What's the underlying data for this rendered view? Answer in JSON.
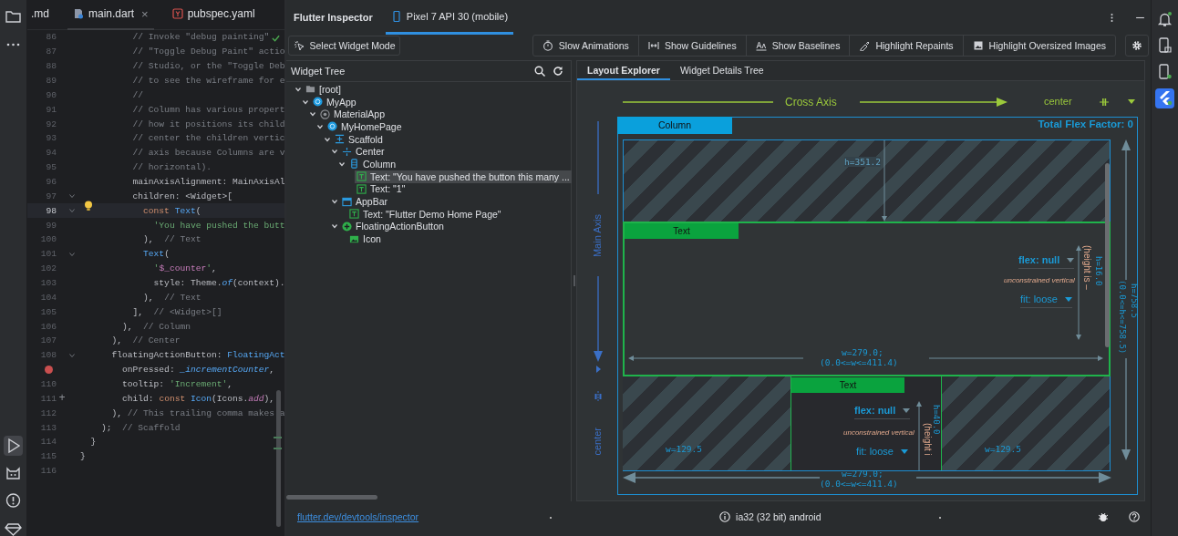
{
  "left_toolbar": {
    "top": [
      {
        "kind": "folder",
        "selected": false
      },
      {
        "kind": "more",
        "selected": false
      }
    ],
    "bottom": [
      {
        "kind": "run",
        "selected": true
      },
      {
        "kind": "cat",
        "selected": false
      },
      {
        "kind": "problems",
        "selected": false
      },
      {
        "kind": "gem",
        "selected": false
      }
    ]
  },
  "editor": {
    "tabs": [
      {
        "label": ".md",
        "kind": "md",
        "selected": false,
        "closable": false
      },
      {
        "label": "main.dart",
        "kind": "dart",
        "selected": true,
        "closable": true
      },
      {
        "label": "pubspec.yaml",
        "kind": "yaml",
        "selected": false,
        "closable": false
      }
    ],
    "close_glyph": "×",
    "lines": [
      {
        "number": "86",
        "tokens": [
          {
            "kind": "comment",
            "text": "          // Invoke \"debug painting\""
          }
        ]
      },
      {
        "number": "87",
        "tokens": [
          {
            "kind": "comment",
            "text": "          // \"Toggle Debug Paint\" actio"
          }
        ]
      },
      {
        "number": "88",
        "tokens": [
          {
            "kind": "comment",
            "text": "          // Studio, or the \"Toggle Deb"
          }
        ]
      },
      {
        "number": "89",
        "tokens": [
          {
            "kind": "comment",
            "text": "          // to see the wireframe for e"
          }
        ]
      },
      {
        "number": "90",
        "tokens": [
          {
            "kind": "comment",
            "text": "          //"
          }
        ]
      },
      {
        "number": "91",
        "tokens": [
          {
            "kind": "comment",
            "text": "          // Column has various propert"
          }
        ]
      },
      {
        "number": "92",
        "tokens": [
          {
            "kind": "comment",
            "text": "          // how it positions its child"
          }
        ]
      },
      {
        "number": "93",
        "tokens": [
          {
            "kind": "comment",
            "text": "          // center the children vertic"
          }
        ]
      },
      {
        "number": "94",
        "tokens": [
          {
            "kind": "comment",
            "text": "          // axis because Columns are v"
          }
        ]
      },
      {
        "number": "95",
        "tokens": [
          {
            "kind": "comment",
            "text": "          // horizontal)."
          }
        ]
      },
      {
        "number": "96",
        "tokens": [
          {
            "kind": "plain",
            "text": "          mainAxisAlignment: MainAxisAl"
          }
        ]
      },
      {
        "number": "97",
        "fold": true,
        "tokens": [
          {
            "kind": "plain",
            "text": "          children: <Widget>["
          }
        ]
      },
      {
        "number": "98",
        "fold": true,
        "current": true,
        "bulb": true,
        "tokens": [
          {
            "kind": "keyword",
            "text": "            const"
          },
          {
            "kind": "class",
            "text": " Text"
          },
          {
            "kind": "plain",
            "text": "("
          }
        ]
      },
      {
        "number": "99",
        "tokens": [
          {
            "kind": "string",
            "text": "              'You have pushed the butt"
          }
        ]
      },
      {
        "number": "100",
        "tokens": [
          {
            "kind": "plain",
            "text": "            ),  "
          },
          {
            "kind": "comment",
            "text": "// Text"
          }
        ]
      },
      {
        "number": "101",
        "fold": true,
        "tokens": [
          {
            "kind": "class",
            "text": "            Text"
          },
          {
            "kind": "plain",
            "text": "("
          }
        ]
      },
      {
        "number": "102",
        "tokens": [
          {
            "kind": "string",
            "text": "              '"
          },
          {
            "kind": "interp",
            "text": "$_counter"
          },
          {
            "kind": "string",
            "text": "'"
          },
          {
            "kind": "plain",
            "text": ","
          }
        ]
      },
      {
        "number": "103",
        "tokens": [
          {
            "kind": "plain",
            "text": "              style: Theme."
          },
          {
            "kind": "method",
            "text": "of"
          },
          {
            "kind": "plain",
            "text": "(context)."
          }
        ]
      },
      {
        "number": "104",
        "tokens": [
          {
            "kind": "plain",
            "text": "            ),  "
          },
          {
            "kind": "comment",
            "text": "// Text"
          }
        ]
      },
      {
        "number": "105",
        "tokens": [
          {
            "kind": "plain",
            "text": "          ],  "
          },
          {
            "kind": "comment",
            "text": "// <Widget>[]"
          }
        ]
      },
      {
        "number": "106",
        "tokens": [
          {
            "kind": "plain",
            "text": "        ),  "
          },
          {
            "kind": "comment",
            "text": "// Column"
          }
        ]
      },
      {
        "number": "107",
        "tokens": [
          {
            "kind": "plain",
            "text": "      ),  "
          },
          {
            "kind": "comment",
            "text": "// Center"
          }
        ]
      },
      {
        "number": "108",
        "fold": true,
        "tokens": [
          {
            "kind": "plain",
            "text": "      floatingActionButton: "
          },
          {
            "kind": "class",
            "text": "FloatingAct"
          }
        ]
      },
      {
        "breakpoint": true,
        "tokens": [
          {
            "kind": "plain",
            "text": "        onPressed: "
          },
          {
            "kind": "method",
            "text": "_incrementCounter"
          },
          {
            "kind": "plain",
            "text": ","
          }
        ]
      },
      {
        "number": "110",
        "tokens": [
          {
            "kind": "plain",
            "text": "        tooltip: "
          },
          {
            "kind": "string",
            "text": "'Increment'"
          },
          {
            "kind": "plain",
            "text": ","
          }
        ]
      },
      {
        "number": "111",
        "gutter_mark": "+",
        "tokens": [
          {
            "kind": "plain",
            "text": "        child: "
          },
          {
            "kind": "keyword",
            "text": "const"
          },
          {
            "kind": "class",
            "text": " Icon"
          },
          {
            "kind": "plain",
            "text": "(Icons."
          },
          {
            "kind": "field",
            "text": "add"
          },
          {
            "kind": "plain",
            "text": "),"
          }
        ]
      },
      {
        "number": "112",
        "tokens": [
          {
            "kind": "plain",
            "text": "      ), "
          },
          {
            "kind": "comment",
            "text": "// This trailing comma makes a"
          }
        ]
      },
      {
        "number": "113",
        "tokens": [
          {
            "kind": "plain",
            "text": "    );  "
          },
          {
            "kind": "comment",
            "text": "// Scaffold"
          }
        ]
      },
      {
        "number": "114",
        "tokens": [
          {
            "kind": "plain",
            "text": "  }"
          }
        ]
      },
      {
        "number": "115",
        "tokens": [
          {
            "kind": "plain",
            "text": "}"
          }
        ]
      },
      {
        "number": "116"
      }
    ]
  },
  "inspector": {
    "title": "Flutter Inspector",
    "tabs": [
      {
        "label": "Pixel 7 API 30 (mobile)",
        "selected": true
      }
    ],
    "select_mode": {
      "label": "Select Widget Mode",
      "on": false
    },
    "toggles": [
      {
        "label": "Slow Animations",
        "kind": "timer",
        "on": false
      },
      {
        "label": "Show Guidelines",
        "kind": "guides",
        "on": false
      },
      {
        "label": "Show Baselines",
        "kind": "baselines",
        "on": false
      },
      {
        "label": "Highlight Repaints",
        "kind": "repaint",
        "on": false
      },
      {
        "label": "Highlight Oversized Images",
        "kind": "image",
        "on": false
      }
    ],
    "widget_tree": {
      "title": "Widget Tree",
      "items": [
        {
          "label": "[root]",
          "kind": "folder",
          "expanded": true,
          "selected": false,
          "children": [
            {
              "label": "MyApp",
              "kind": "widget",
              "expanded": true,
              "selected": false,
              "children": [
                {
                  "label": "MaterialApp",
                  "kind": "material",
                  "expanded": true,
                  "selected": false,
                  "children": [
                    {
                      "label": "MyHomePage",
                      "kind": "widget",
                      "expanded": true,
                      "selected": false,
                      "children": [
                        {
                          "label": "Scaffold",
                          "kind": "scaffold",
                          "expanded": true,
                          "selected": false,
                          "children": [
                            {
                              "label": "Center",
                              "kind": "center",
                              "expanded": true,
                              "selected": false,
                              "children": [
                                {
                                  "label": "Column",
                                  "kind": "column",
                                  "expanded": true,
                                  "selected": false,
                                  "children": [
                                    {
                                      "label": "Text: \"You have pushed the button this many ...",
                                      "kind": "text",
                                      "selected": true
                                    },
                                    {
                                      "label": "Text: \"1\"",
                                      "kind": "text",
                                      "selected": false
                                    }
                                  ]
                                }
                              ]
                            },
                            {
                              "label": "AppBar",
                              "kind": "appbar",
                              "expanded": true,
                              "selected": false,
                              "children": [
                                {
                                  "label": "Text: \"Flutter Demo Home Page\"",
                                  "kind": "text",
                                  "selected": false
                                }
                              ]
                            },
                            {
                              "label": "FloatingActionButton",
                              "kind": "fab",
                              "expanded": true,
                              "selected": false,
                              "children": [
                                {
                                  "label": "Icon",
                                  "kind": "image",
                                  "selected": false
                                }
                              ]
                            }
                          ]
                        }
                      ]
                    }
                  ]
                }
              ]
            }
          ]
        }
      ]
    },
    "detail_tabs": [
      {
        "label": "Layout Explorer",
        "selected": true
      },
      {
        "label": "Widget Details Tree",
        "selected": false
      }
    ],
    "layout_explorer": {
      "cross_axis": {
        "label": "Cross Axis",
        "alignment": "center"
      },
      "main_axis": {
        "label": "Main Axis",
        "alignment": "center"
      },
      "widget": {
        "label": "Column",
        "total_flex": "Total Flex Factor: 0",
        "width": "w=279.0;",
        "width_constraint": "(0.0<=w<=411.4)",
        "height": "h=758.5",
        "height_constraint": "(0.0<=h<=758.5)"
      },
      "free_space": "h=351.2",
      "children": [
        {
          "label": "Text",
          "flex": "flex: null",
          "note": "unconstrained vertical",
          "fit": "fit: loose",
          "height": "h=16.0",
          "height_note": "(height is –",
          "width": "w=279.0;",
          "width_constraint": "(0.0<=w<=411.4)"
        },
        {
          "label": "Text",
          "flex": "flex: null",
          "note": "unconstrained vertical",
          "fit": "fit: loose",
          "height": "h=40.0",
          "height_note": "(height i",
          "side_spaces": [
            "w=129.5",
            "w=129.5"
          ]
        }
      ]
    },
    "status": {
      "link": "flutter.dev/devtools/inspector",
      "device": "ia32 (32 bit) android"
    }
  },
  "right_toolbar": [
    {
      "kind": "bell",
      "selected": false
    },
    {
      "kind": "device",
      "selected": false
    },
    {
      "kind": "device-run",
      "selected": false
    },
    {
      "kind": "flutter",
      "selected": true
    }
  ]
}
